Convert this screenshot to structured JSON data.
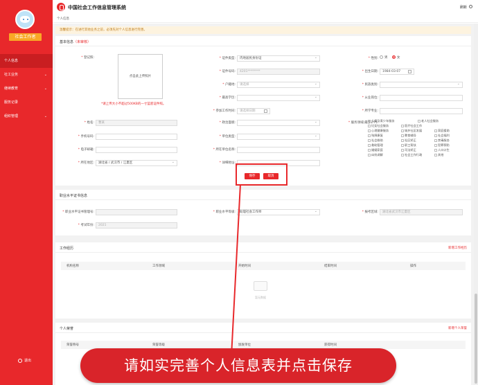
{
  "app": {
    "title": "中国社会工作信息管理系统",
    "user": "刷新"
  },
  "breadcrumb": "个人信息",
  "sidebar": {
    "role": "社会工作者",
    "items": [
      {
        "label": "个人信息",
        "chev": ""
      },
      {
        "label": "社工业务",
        "chev": "⌄"
      },
      {
        "label": "继续教育",
        "chev": "⌄"
      },
      {
        "label": "服务记录",
        "chev": ""
      },
      {
        "label": "组织管理",
        "chev": "⌄"
      }
    ],
    "logout": "退出"
  },
  "notice": "温馨提示：在进行其他业务之前，必须先对个人信息进行完善。",
  "basic": {
    "title": "基本信息",
    "status": "（未审核）",
    "photo_label": "登记照:",
    "upload_text": "点击此上传照片",
    "upload_tip": "*请上传大小不超过500KB的一寸蓝底证件照。",
    "name_label": "姓名:",
    "name_value": "曹某",
    "phone_label": "手机号码:",
    "phone_value": "",
    "email_label": "电子邮箱:",
    "email_value": "",
    "region_label": "所在地区:",
    "region_value": "湖北省 / 武汉市 / 江夏区",
    "idtype_label": "证件类型:",
    "idtype_value": "内地居民身份证",
    "idno_label": "证件号码:",
    "idno_value": "4201********",
    "hukou_label": "户籍地:",
    "hukou_value": "请选择",
    "edu_label": "最高学历:",
    "edu_value": "",
    "worktime_label": "参加工作时间:",
    "worktime_value": "请选择日期",
    "political_label": "政治面貌:",
    "political_value": "",
    "unittype_label": "单位类型:",
    "unittype_value": "",
    "unitname_label": "所在单位名称:",
    "unitname_value": "",
    "address_label": "详细地址:",
    "address_value": "",
    "gender_label": "性别:",
    "male": "男",
    "female": "女",
    "birth_label": "出生日期:",
    "birth_value": "1984-03-07",
    "nation_label": "民族类别:",
    "nation_value": "",
    "job_label": "从业岗位:",
    "job_value": "",
    "major_label": "所学专业:",
    "major_value": "",
    "service_label": "服务领域(最多2个):",
    "service_options": [
      "儿童及青少年服务",
      "老人社会服务",
      "妇女社会服务",
      "医疗社会工作",
      "心理健康服务",
      "城乡社区发展",
      "家庭援助",
      "残障康复",
      "教育辅导",
      "社会福利",
      "社会救助",
      "社区矫正",
      "禁毒服务",
      "救助管理",
      "职工帮扶",
      "犯罪预防",
      "婚姻家庭",
      "司法矫正",
      "人口计生",
      "纠纷调解",
      "社会工作行政",
      "其他"
    ],
    "save": "保存",
    "cancel": "取消"
  },
  "cert": {
    "title": "职业水平证书信息",
    "certno_label": "职业水平证书管理号:",
    "certno_value": "",
    "level_label": "职业水平等级:",
    "level_value": "助理社会工作师",
    "area_label": "报考区域:",
    "area_value": "湖北省武汉市江夏区",
    "examid_label": "考试年份:",
    "examid_value": "2021"
  },
  "work": {
    "title": "工作经历",
    "add": "新增工作经历",
    "cols": [
      "机构名称",
      "工作领域",
      "开始时间",
      "结束时间",
      "操作"
    ],
    "empty": "暂无数据"
  },
  "honor": {
    "title": "个人荣誉",
    "add": "新增个人荣誉",
    "cols": [
      "荣誉称号",
      "荣誉等级",
      "颁发单位",
      "获得时间"
    ]
  },
  "banner": "请如实完善个人信息表并点击保存",
  "colors": {
    "brand": "#e8282b",
    "badge": "#f9a825",
    "notice": "#fdf3df"
  }
}
